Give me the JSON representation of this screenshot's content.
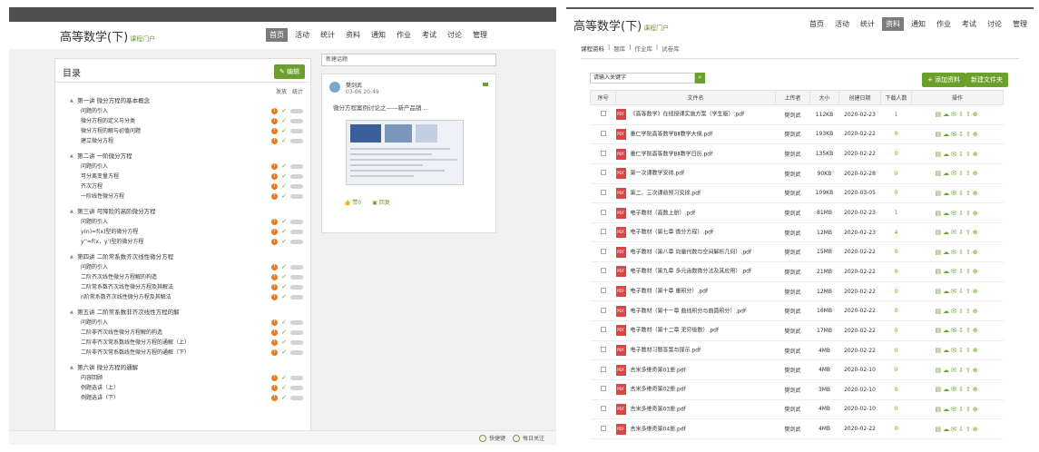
{
  "left": {
    "title": "高等数学(下)",
    "subtitle": "课程门户",
    "nav": [
      "首页",
      "活动",
      "统计",
      "资料",
      "通知",
      "作业",
      "考试",
      "讨论",
      "管理"
    ],
    "toc_title": "目录",
    "edit_label": "✎ 编辑",
    "col_publish": "发放",
    "col_stats": "统计",
    "chapters": [
      {
        "title": "第一讲 微分方程的基本概念",
        "sections": [
          "问题的引入",
          "微分方程的定义与分类",
          "微分方程的解与初值问题",
          "建立微分方程"
        ]
      },
      {
        "title": "第二讲 一阶微分方程",
        "sections": [
          "问题的引入",
          "可分离变量方程",
          "齐次方程",
          "一阶线性微分方程"
        ]
      },
      {
        "title": "第三讲 可降阶的高阶微分方程",
        "sections": [
          "问题的引入",
          "y(n)=f(x)型的微分方程",
          "y''=f(x，y')型的微分方程"
        ]
      },
      {
        "title": "第四讲 二阶常系数齐次线性微分方程",
        "sections": [
          "问题的引入",
          "二阶齐次线性微分方程解的构造",
          "二阶常系数齐次线性微分方程及其解法",
          "n阶常系数齐次线性微分方程及其解法"
        ]
      },
      {
        "title": "第五讲 二阶常系数非齐次线性方程的解",
        "sections": [
          "问题的引入",
          "二阶非齐次线性微分方程解的构造",
          "二阶非齐次常系数线性微分方程的通解（上）",
          "二阶非齐次常系数线性微分方程的通解（下）"
        ]
      },
      {
        "title": "第六讲 微分方程的通解",
        "sections": [
          "内容回顾",
          "例题选讲（上）",
          "例题选讲（下）"
        ]
      }
    ],
    "discussion": {
      "input_value": "新建话题",
      "author": "樊剑武",
      "time": "03-06 20:49",
      "post_title": "微分方程案例讨论之——新产品销 ...",
      "like": "赞0",
      "reply": "回复"
    },
    "footer": {
      "quick": "快捷键",
      "daily": "每日关注"
    }
  },
  "right": {
    "title": "高等数学(下)",
    "subtitle": "课程门户",
    "nav": [
      "首页",
      "活动",
      "统计",
      "资料",
      "通知",
      "作业",
      "考试",
      "讨论",
      "管理"
    ],
    "active_nav": "资料",
    "tabs": [
      "课程资料",
      "题库",
      "作业库",
      "试卷库"
    ],
    "search_value": "请输入关键字",
    "add_button": "+ 添加资料",
    "new_folder_button": "新建文件夹",
    "columns": [
      "序号",
      "文件名",
      "上传者",
      "大小",
      "创建日期",
      "下载人数",
      "操作"
    ],
    "rows": [
      {
        "name": "《高等数学》在线授课实施方案（学生版）.pdf",
        "uploader": "樊剑武",
        "size": "112KB",
        "date": "2020-02-23",
        "downloads": "1"
      },
      {
        "name": "重仁学院高等数学BⅡ教学大纲.pdf",
        "uploader": "樊剑武",
        "size": "193KB",
        "date": "2020-02-22",
        "downloads": "0"
      },
      {
        "name": "重仁学院高等数学BⅡ教学日历.pdf",
        "uploader": "樊剑武",
        "size": "135KB",
        "date": "2020-02-22",
        "downloads": "0"
      },
      {
        "name": "第一次课教学安排.pdf",
        "uploader": "樊剑武",
        "size": "90KB",
        "date": "2020-02-28",
        "downloads": "0"
      },
      {
        "name": "第二、三次课前预习安排.pdf",
        "uploader": "樊剑武",
        "size": "109KB",
        "date": "2020-03-05",
        "downloads": "0"
      },
      {
        "name": "电子教材（高数上册）.pdf",
        "uploader": "樊剑武",
        "size": "81MB",
        "date": "2020-02-23",
        "downloads": "1"
      },
      {
        "name": "电子教材（第七章 微分方程）.pdf",
        "uploader": "樊剑武",
        "size": "12MB",
        "date": "2020-02-23",
        "downloads": "4"
      },
      {
        "name": "电子教材（第八章 向量代数与空间解析几何）.pdf",
        "uploader": "樊剑武",
        "size": "15MB",
        "date": "2020-02-22",
        "downloads": "0"
      },
      {
        "name": "电子教材（第九章 多元函数微分法及其应用）.pdf",
        "uploader": "樊剑武",
        "size": "21MB",
        "date": "2020-02-22",
        "downloads": "0"
      },
      {
        "name": "电子教材（第十章 重积分）.pdf",
        "uploader": "樊剑武",
        "size": "12MB",
        "date": "2020-02-22",
        "downloads": "0"
      },
      {
        "name": "电子教材（第十一章 曲线积分与曲面积分）.pdf",
        "uploader": "樊剑武",
        "size": "16MB",
        "date": "2020-02-22",
        "downloads": "0"
      },
      {
        "name": "电子教材（第十二章 无穷级数）.pdf",
        "uploader": "樊剑武",
        "size": "17MB",
        "date": "2020-02-22",
        "downloads": "0"
      },
      {
        "name": "电子教材习题答案与提示.pdf",
        "uploader": "樊剑武",
        "size": "4MB",
        "date": "2020-02-22",
        "downloads": "0"
      },
      {
        "name": "吉米多维奇第01册.pdf",
        "uploader": "樊剑武",
        "size": "4MB",
        "date": "2020-02-10",
        "downloads": "0"
      },
      {
        "name": "吉米多维奇第02册.pdf",
        "uploader": "樊剑武",
        "size": "3MB",
        "date": "2020-02-10",
        "downloads": "0"
      },
      {
        "name": "吉米多维奇第03册.pdf",
        "uploader": "樊剑武",
        "size": "4MB",
        "date": "2020-02-10",
        "downloads": "0"
      },
      {
        "name": "吉米多维奇第04册.pdf",
        "uploader": "樊剑武",
        "size": "4MB",
        "date": "2020-02-22",
        "downloads": "0"
      }
    ],
    "colors": {
      "accent": "#6aa02b",
      "warn": "#f07a1a"
    }
  }
}
